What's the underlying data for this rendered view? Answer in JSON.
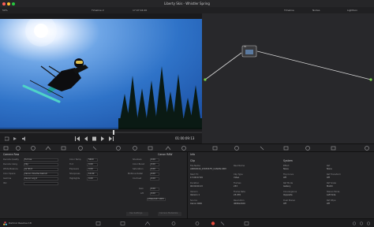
{
  "window": {
    "title": "Liberty Skis - Whistler Spring",
    "left_value": "50%",
    "timeline": "Timeline 2",
    "timecode_top": "17:07:04:20",
    "right_menu": [
      "Timeline",
      "Nodes",
      "Lightbox"
    ]
  },
  "toolbar": {
    "items": [
      "Gallery",
      "LUTs",
      "Media Pool",
      "Clips",
      "Timeline",
      "Nodes",
      "Lightbox"
    ]
  },
  "viewer": {
    "timecode": "01:00:09:13",
    "tool_label": "Group Pre-Clip"
  },
  "nodes": {
    "label": "01"
  },
  "camera_raw": {
    "header": "Camera Raw",
    "decode_label": "Decode Quality",
    "decode_value": "Full res - Premium",
    "rows": [
      {
        "label": "Decode Quality",
        "value": "Full res"
      },
      {
        "label": "Decode Using",
        "value": "Clip"
      },
      {
        "label": "White Balance",
        "value": "As Shot"
      },
      {
        "label": "Color Space",
        "value": "Canon Cinema Gamut"
      },
      {
        "label": "Gamma",
        "value": "Canon Log 2"
      },
      {
        "label": "ISO",
        "value": ""
      }
    ],
    "middle_rows": [
      {
        "label": "Color Temp",
        "value": "5600"
      },
      {
        "label": "Tint",
        "value": "0.00"
      },
      {
        "label": "Exposure",
        "value": "0.00"
      },
      {
        "label": "Sharpness",
        "value": "10.00"
      },
      {
        "label": "Highlights",
        "value": "0.00"
      }
    ],
    "right_header": "Canon RAW",
    "right_rows": [
      {
        "label": "Shadows",
        "value": "0.00"
      },
      {
        "label": "Color Boost",
        "value": "0.00"
      },
      {
        "label": "Saturation",
        "value": "0.00"
      },
      {
        "label": "Midtone Detail",
        "value": "0.00"
      },
      {
        "label": "Contrast",
        "value": "0.00"
      },
      {
        "label": "Gain",
        "value": "0.00"
      },
      {
        "label": "Lift",
        "value": "0.00"
      }
    ],
    "footer": "AH9A2187.CRM",
    "buttons": [
      "Use Settings",
      "Camera Metadata"
    ]
  },
  "info": {
    "header": "Info",
    "clip_header": "Clip",
    "system_header": "System",
    "clip": [
      {
        "label": "File Name",
        "value": "A006C044_230531FH_CANON.CRM"
      },
      {
        "label": "Start TC",
        "value": "17:06:57:09"
      },
      {
        "label": "Duration",
        "value": "00:00:09:13"
      },
      {
        "label": "Version",
        "value": "Version 1"
      },
      {
        "label": "Source",
        "value": "Canon RAW"
      }
    ],
    "clip_col2": [
      {
        "label": "Reel Name",
        "value": ""
      },
      {
        "label": "Clip Type",
        "value": "Video"
      },
      {
        "label": "Frames",
        "value": "233"
      },
      {
        "label": "Frame Rate",
        "value": "23.976"
      },
      {
        "label": "Resolution",
        "value": "4096x2160"
      }
    ],
    "system": [
      {
        "label": "Effect",
        "value": "None"
      },
      {
        "label": "Flip Curve",
        "value": "Off"
      },
      {
        "label": "Ref Mode",
        "value": "Gallery"
      },
      {
        "label": "Convergence",
        "value": "Opposite"
      },
      {
        "label": "Dual Stereo",
        "value": "Off"
      }
    ],
    "system_col2": [
      {
        "label": "Ref",
        "value": "None"
      },
      {
        "label": "Ref Transform",
        "value": "Off"
      },
      {
        "label": "Ref Scale",
        "value": "Match"
      },
      {
        "label": "Stereo Mode",
        "value": "Left Side"
      },
      {
        "label": "Ref Wipe",
        "value": "Off"
      }
    ]
  },
  "footer": {
    "app": "DaVinci Resolve 18"
  },
  "colors": {
    "accent": "#e64b3c",
    "node_line": "#d8d8d8",
    "green_dot": "#7ad14d"
  }
}
